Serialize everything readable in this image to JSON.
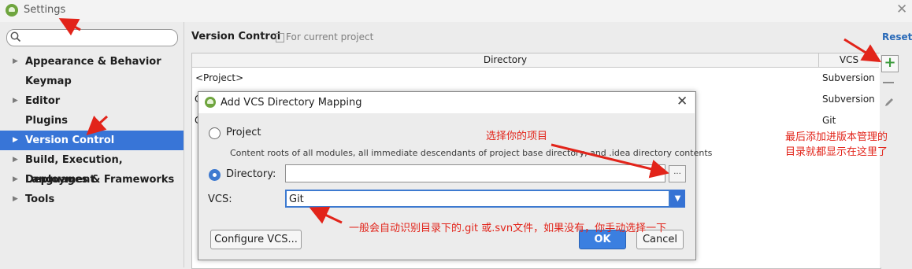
{
  "window": {
    "title": "Settings"
  },
  "search": {
    "placeholder": ""
  },
  "sidebar": {
    "items": [
      {
        "label": "Appearance & Behavior",
        "expandable": true,
        "selected": false
      },
      {
        "label": "Keymap",
        "expandable": false,
        "selected": false
      },
      {
        "label": "Editor",
        "expandable": true,
        "selected": false
      },
      {
        "label": "Plugins",
        "expandable": false,
        "selected": false
      },
      {
        "label": "Version Control",
        "expandable": true,
        "selected": true
      },
      {
        "label": "Build, Execution, Deployment",
        "expandable": true,
        "selected": false
      },
      {
        "label": "Languages & Frameworks",
        "expandable": true,
        "selected": false
      },
      {
        "label": "Tools",
        "expandable": true,
        "selected": false
      }
    ]
  },
  "header": {
    "title": "Version Control",
    "subtitle": "For current project",
    "reset_label": "Reset"
  },
  "mappings": {
    "columns": [
      "Directory",
      "VCS"
    ],
    "rows": [
      {
        "directory": "<Project>",
        "vcs": "Subversion"
      },
      {
        "directory": "C",
        "vcs": "Subversion"
      },
      {
        "directory": "C",
        "vcs": "Git"
      }
    ]
  },
  "dialog": {
    "title": "Add VCS Directory Mapping",
    "option_project": "Project",
    "project_description": "Content roots of all modules, all immediate descendants of project base directory, and .idea directory contents",
    "option_directory": "Directory:",
    "directory_value": "",
    "browse_label": "...",
    "vcs_label": "VCS:",
    "vcs_value": "Git",
    "selected_option": "Directory",
    "configure_label": "Configure VCS...",
    "ok_label": "OK",
    "cancel_label": "Cancel"
  },
  "annotations": {
    "select_project": "选择你的项目",
    "added_note_line1": "最后添加进版本管理的",
    "added_note_line2": "目录就都显示在这里了",
    "vcs_note": "一般会自动识别目录下的.git 或.svn文件，如果没有，你手动选择一下"
  },
  "colors": {
    "accent": "#3875d7",
    "annotation": "#e2241a",
    "ok_button": "#3b7fe0"
  },
  "icons": [
    "android-studio-icon",
    "search-icon",
    "close-icon",
    "project-icon",
    "add-icon",
    "remove-icon",
    "edit-icon",
    "chevron-down-icon"
  ]
}
